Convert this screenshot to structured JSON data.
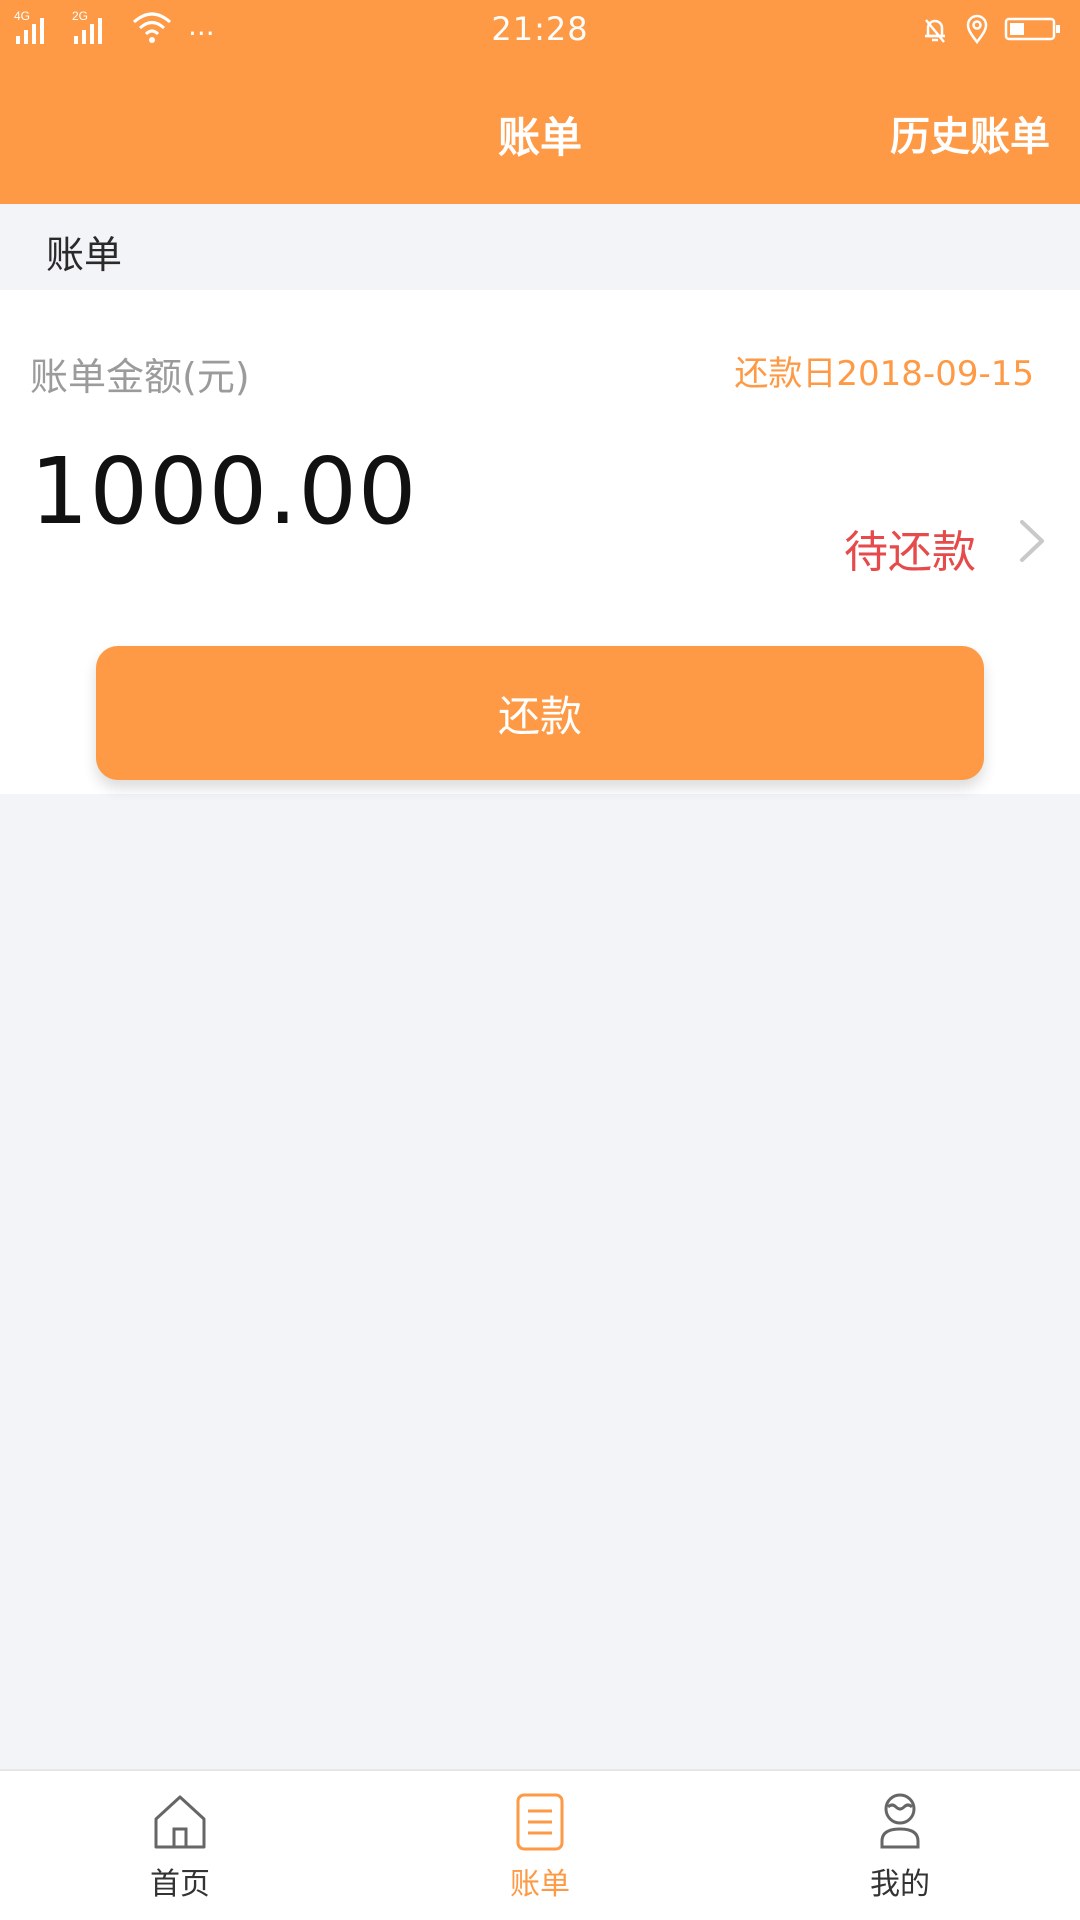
{
  "status_bar": {
    "signal_1_label": "4G",
    "signal_2_label": "2G",
    "more": "···",
    "time": "21:28",
    "icons": [
      "mute-bell-icon",
      "location-icon",
      "battery-icon"
    ]
  },
  "nav": {
    "title": "账单",
    "right_action": "历史账单"
  },
  "section": {
    "title": "账单"
  },
  "bill": {
    "amount_label": "账单金额(元)",
    "due_date": "还款日2018-09-15",
    "amount": "1000.00",
    "status": "待还款",
    "repay_button": "还款"
  },
  "tabs": [
    {
      "label": "首页",
      "icon": "home-icon",
      "active": false
    },
    {
      "label": "账单",
      "icon": "bill-icon",
      "active": true
    },
    {
      "label": "我的",
      "icon": "profile-icon",
      "active": false
    }
  ],
  "colors": {
    "accent": "#fe9a45",
    "alert": "#e64a4a",
    "background": "#f3f4f8"
  }
}
